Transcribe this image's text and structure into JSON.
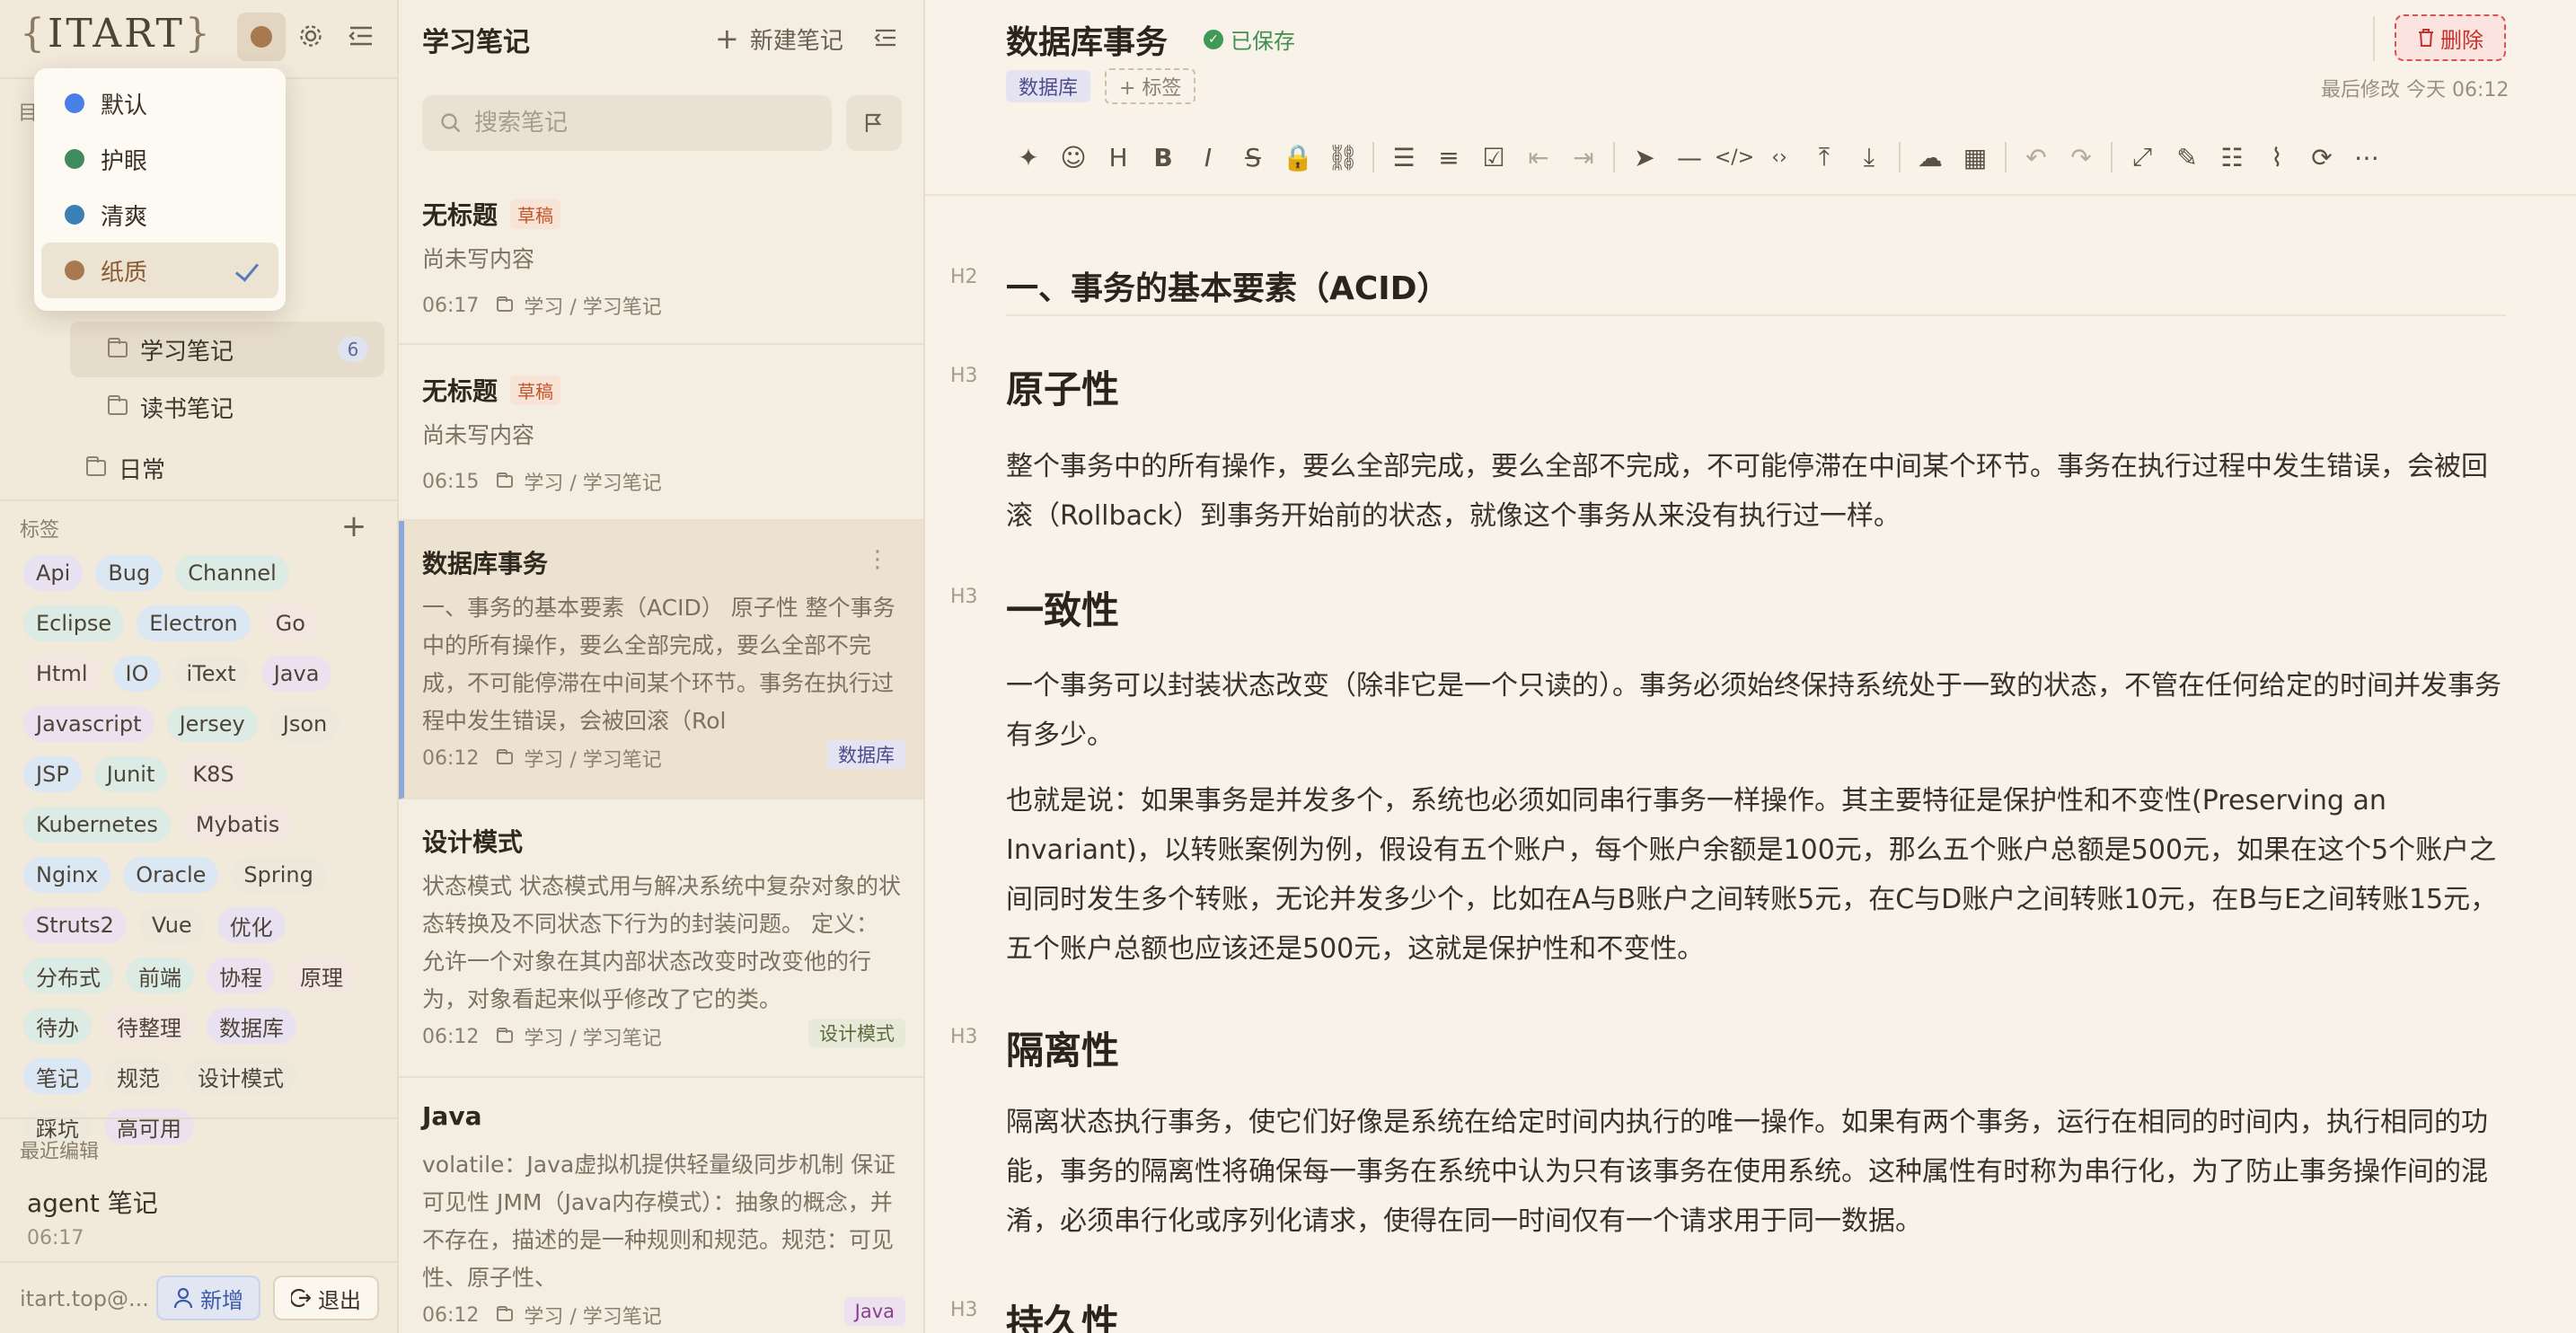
{
  "sidebar": {
    "logo": "ITART",
    "folder_label_partial": "目",
    "folders": [
      {
        "label": "学习笔记",
        "count": "6"
      },
      {
        "label": "读书笔记"
      },
      {
        "label": "日常"
      }
    ],
    "tags_title": "标签",
    "tags": [
      {
        "label": "Api",
        "color": "#e7e1f2"
      },
      {
        "label": "Bug",
        "color": "#dce7f4"
      },
      {
        "label": "Channel",
        "color": "#dcebe4"
      },
      {
        "label": "Eclipse",
        "color": "#dcebe4"
      },
      {
        "label": "Electron",
        "color": "#dce7f4"
      },
      {
        "label": "Go",
        "color": "#f3e5e0"
      },
      {
        "label": "Html",
        "color": "#f3e5e0"
      },
      {
        "label": "IO",
        "color": "#dce7f4"
      },
      {
        "label": "iText",
        "color": "#ece8dc"
      },
      {
        "label": "Java",
        "color": "#ede1ef"
      },
      {
        "label": "Javascript",
        "color": "#ede1ef"
      },
      {
        "label": "Jersey",
        "color": "#dcebe4"
      },
      {
        "label": "Json",
        "color": "#ece8dc"
      },
      {
        "label": "JSP",
        "color": "#dce7f4"
      },
      {
        "label": "Junit",
        "color": "#dcebe4"
      },
      {
        "label": "K8S",
        "color": "#f3e5e0"
      },
      {
        "label": "Kubernetes",
        "color": "#dcebe4"
      },
      {
        "label": "Mybatis",
        "color": "#f3e5e0"
      },
      {
        "label": "Nginx",
        "color": "#dce7f4"
      },
      {
        "label": "Oracle",
        "color": "#dce7f4"
      },
      {
        "label": "Spring",
        "color": "#ece8dc"
      },
      {
        "label": "Struts2",
        "color": "#ede1ef"
      },
      {
        "label": "Vue",
        "color": "#ece8dc"
      },
      {
        "label": "优化",
        "color": "#e7e1f2"
      },
      {
        "label": "分布式",
        "color": "#dcebe4"
      },
      {
        "label": "前端",
        "color": "#dcebe4"
      },
      {
        "label": "协程",
        "color": "#ede1ef"
      },
      {
        "label": "原理",
        "color": "#f3e5e0"
      },
      {
        "label": "待办",
        "color": "#dcebe4"
      },
      {
        "label": "待整理",
        "color": "#f3e5e0"
      },
      {
        "label": "数据库",
        "color": "#e7e1f2"
      },
      {
        "label": "笔记",
        "color": "#dce7f4"
      },
      {
        "label": "规范",
        "color": "#ece8dc"
      },
      {
        "label": "设计模式",
        "color": "#ece8dc"
      },
      {
        "label": "踩坑",
        "color": "#ece8dc"
      },
      {
        "label": "高可用",
        "color": "#ede1ef"
      }
    ],
    "recent_title": "最近编辑",
    "recent": {
      "title": "agent 笔记",
      "time": "06:17"
    },
    "user_email": "itart.top@...",
    "new_label": "新增",
    "logout_label": "退出"
  },
  "theme_menu": {
    "items": [
      {
        "label": "默认",
        "color": "#4a7fe8"
      },
      {
        "label": "护眼",
        "color": "#3f8a5e"
      },
      {
        "label": "清爽",
        "color": "#3a7fb5"
      },
      {
        "label": "纸质",
        "color": "#a8784f",
        "selected": true
      }
    ]
  },
  "list": {
    "title": "学习笔记",
    "new_note_label": "新建笔记",
    "search_placeholder": "搜索笔记",
    "notes": [
      {
        "title": "无标题",
        "draft": "草稿",
        "snippet": "尚未写内容",
        "time": "06:17",
        "path": "学习 / 学习笔记"
      },
      {
        "title": "无标题",
        "draft": "草稿",
        "snippet": "尚未写内容",
        "time": "06:15",
        "path": "学习 / 学习笔记"
      },
      {
        "title": "数据库事务",
        "snippet": "一、事务的基本要素（ACID） 原子性 整个事务中的所有操作，要么全部完成，要么全部不完成，不可能停滞在中间某个环节。事务在执行过程中发生错误，会被回滚（Rol",
        "time": "06:12",
        "path": "学习 / 学习笔记",
        "tag": "数据库"
      },
      {
        "title": "设计模式",
        "snippet": "状态模式 状态模式用与解决系统中复杂对象的状态转换及不同状态下行为的封装问题。 定义： 允许一个对象在其内部状态改变时改变他的行为，对象看起来似乎修改了它的类。",
        "time": "06:12",
        "path": "学习 / 学习笔记",
        "tag": "设计模式"
      },
      {
        "title": "Java",
        "snippet": "volatile：Java虚拟机提供轻量级同步机制 保证可见性 JMM（Java内存模式）：抽象的概念，并不存在，描述的是一种规则和规范。规范：可见性、原子性、",
        "time": "06:12",
        "path": "学习 / 学习笔记",
        "tag": "Java"
      }
    ]
  },
  "editor": {
    "title": "数据库事务",
    "saved_label": "已保存",
    "tag": "数据库",
    "add_tag_label": "+ 标签",
    "delete_label": "删除",
    "last_modified": "最后修改 今天 06:12",
    "heading_markers": {
      "h2": "H2",
      "h3": "H3"
    },
    "h2": "一、事务的基本要素（ACID）",
    "sections": [
      {
        "heading": "原子性",
        "paragraphs": [
          "整个事务中的所有操作，要么全部完成，要么全部不完成，不可能停滞在中间某个环节。事务在执行过程中发生错误，会被回滚（Rollback）到事务开始前的状态，就像这个事务从来没有执行过一样。"
        ]
      },
      {
        "heading": "一致性",
        "paragraphs": [
          "一个事务可以封装状态改变（除非它是一个只读的）。事务必须始终保持系统处于一致的状态，不管在任何给定的时间并发事务有多少。",
          "也就是说：如果事务是并发多个，系统也必须如同串行事务一样操作。其主要特征是保护性和不变性(Preserving an Invariant)，以转账案例为例，假设有五个账户，每个账户余额是100元，那么五个账户总额是500元，如果在这个5个账户之间同时发生多个转账，无论并发多少个，比如在A与B账户之间转账5元，在C与D账户之间转账10元，在B与E之间转账15元，五个账户总额也应该还是500元，这就是保护性和不变性。"
        ]
      },
      {
        "heading": "隔离性",
        "paragraphs": [
          "隔离状态执行事务，使它们好像是系统在给定时间内执行的唯一操作。如果有两个事务，运行在相同的时间内，执行相同的功能，事务的隔离性将确保每一事务在系统中认为只有该事务在使用系统。这种属性有时称为串行化，为了防止事务操作间的混淆，必须串行化或序列化请求，使得在同一时间仅有一个请求用于同一数据。"
        ]
      },
      {
        "heading": "持久性"
      }
    ],
    "toolbar_icons": [
      "sparkle-icon",
      "emoji-icon",
      "heading-icon",
      "bold-icon",
      "italic-icon",
      "strikethrough-icon",
      "lock-icon",
      "link-icon",
      "bullet-list-icon",
      "ordered-list-icon",
      "checklist-icon",
      "outdent-icon",
      "indent-icon",
      "quote-icon",
      "hr-icon",
      "code-block-icon",
      "inline-code-icon",
      "insert-before-icon",
      "insert-after-icon",
      "upload-icon",
      "table-icon",
      "undo-icon",
      "redo-icon",
      "fullscreen-icon",
      "edit-mode-icon",
      "outline-icon",
      "attachment-icon",
      "export-icon",
      "more-icon"
    ]
  },
  "colors": {
    "accent": "#8ea6d8",
    "paper": "#f8f2e8",
    "danger": "#c9302c",
    "saved": "#3f8f4f"
  }
}
